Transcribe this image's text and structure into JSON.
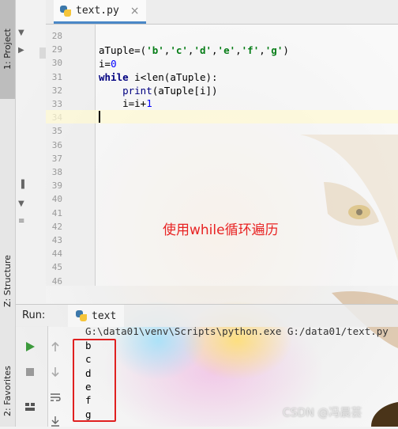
{
  "side_tabs": {
    "project": "1: Project",
    "structure": "Z: Structure",
    "favorites": "2: Favorites"
  },
  "editor_tab": {
    "filename": "text.py",
    "icon": "python-file-icon"
  },
  "line_numbers": [
    "28",
    "29",
    "30",
    "31",
    "32",
    "33",
    "34",
    "35",
    "36",
    "37",
    "38",
    "39",
    "40",
    "41",
    "42",
    "43",
    "44",
    "45",
    "46"
  ],
  "code": {
    "l29_var": "aTuple=(",
    "l29_strings": [
      "'b'",
      "'c'",
      "'d'",
      "'e'",
      "'f'",
      "'g'"
    ],
    "l30_var": "i=",
    "l30_num": "0",
    "l31_kw": "while",
    "l31_rest": " i<len(aTuple):",
    "l32_indent": "    ",
    "l32_fn": "print",
    "l32_rest": "(aTuple[i])",
    "l33_text": "    i=i+",
    "l33_num": "1"
  },
  "annotation": "使用while循环遍历",
  "run": {
    "title": "Run:",
    "tab_label": "text",
    "command": "G:\\data01\\venv\\Scripts\\python.exe G:/data01/text.py",
    "output": [
      "b",
      "c",
      "d",
      "e",
      "f",
      "g"
    ]
  },
  "watermark": "CSDN @冯晨芸",
  "colors": {
    "keyword": "#000080",
    "string": "#067d17",
    "number": "#0000ff",
    "annotation": "#e82323",
    "highlight_box": "#e02020"
  }
}
